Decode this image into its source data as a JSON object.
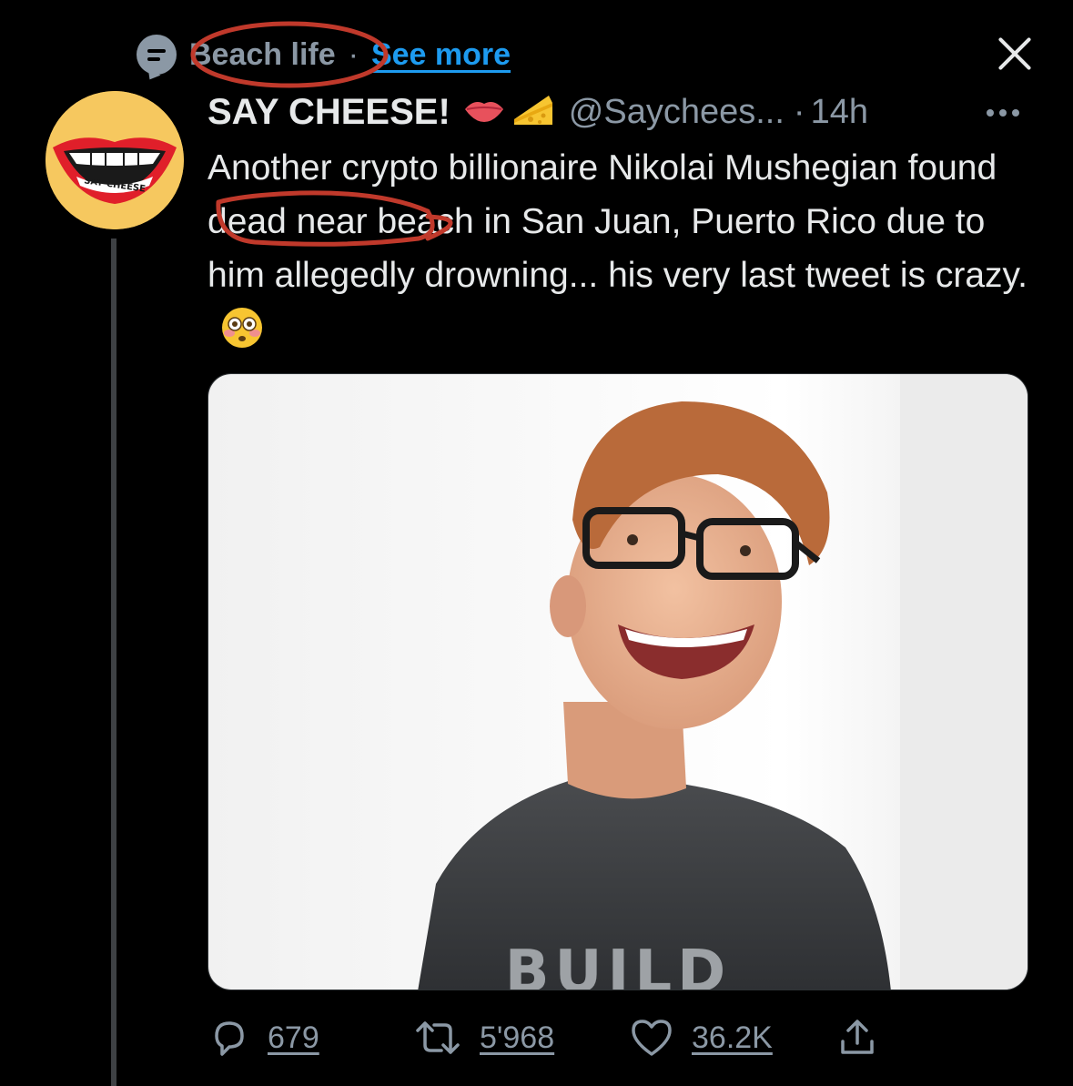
{
  "context": {
    "topic_label": "Beach life",
    "separator": "·",
    "see_more_label": "See more",
    "icon": "topic-icon"
  },
  "close": {
    "icon": "close-icon"
  },
  "tweet": {
    "avatar": {
      "icon": "say-cheese-logo",
      "logo_text": "SAY CHEESE"
    },
    "display_name": "SAY CHEESE!",
    "name_emojis": [
      "lips-emoji",
      "cheese-emoji"
    ],
    "handle": "@Saychees...",
    "separator": "·",
    "timestamp": "14h",
    "more_icon": "more-icon",
    "text_parts": {
      "before": "Another crypto billionaire Nikolai Mushegian found dead near beach in San Juan, Puerto Rico due to him allegedly drowning... his very last tweet is crazy.",
      "emoji": "flushed-face-emoji"
    },
    "media": {
      "description_icon": "photo",
      "shirt_text": "BUILD"
    },
    "actions": {
      "reply_count": "679",
      "retweet_count": "5'968",
      "like_count": "36.2K",
      "share_icon": "share-icon"
    }
  },
  "colors": {
    "background": "#000000",
    "text_primary": "#e7e9ea",
    "text_secondary": "#8b98a5",
    "link": "#1d9bf0",
    "annotation": "#c0392b",
    "avatar_bg": "#f6c85f"
  }
}
